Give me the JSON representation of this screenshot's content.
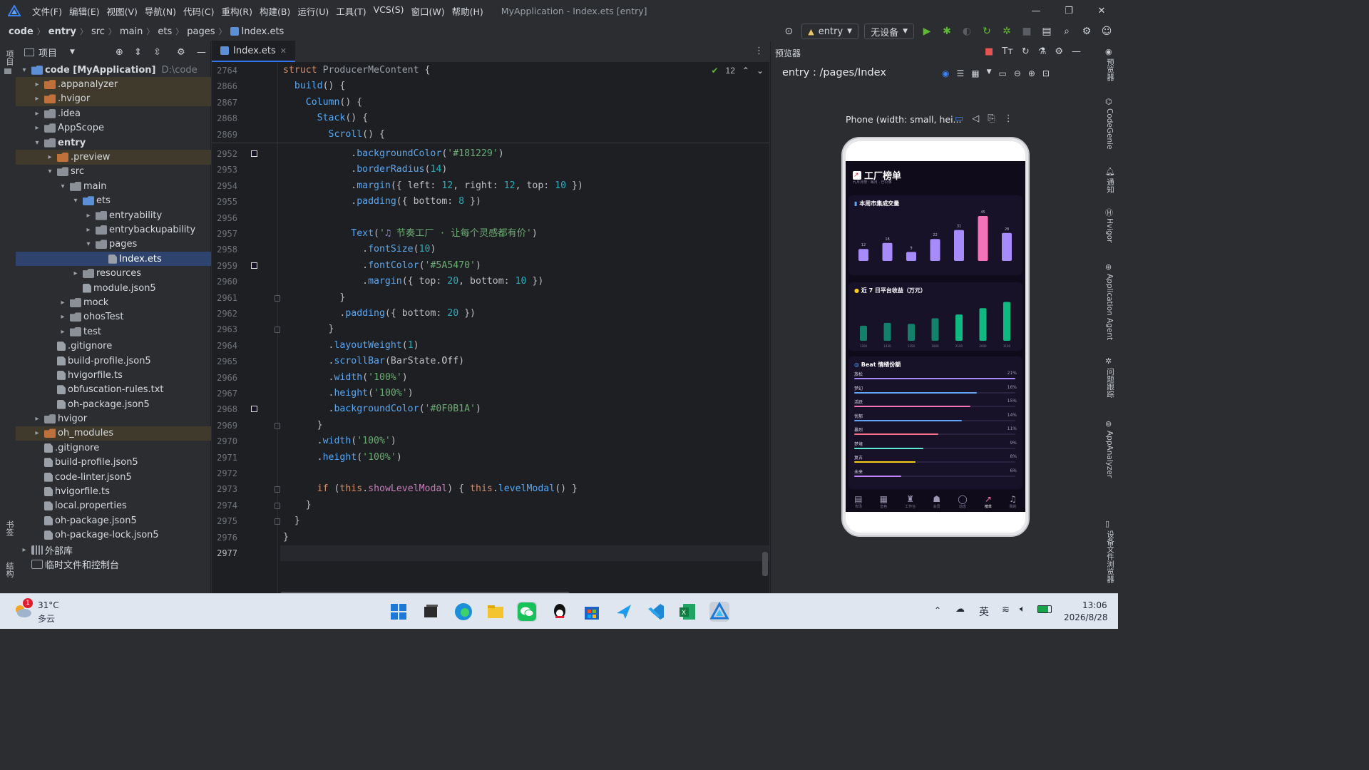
{
  "titlebar": {
    "menus": [
      "文件(F)",
      "编辑(E)",
      "视图(V)",
      "导航(N)",
      "代码(C)",
      "重构(R)",
      "构建(B)",
      "运行(U)",
      "工具(T)",
      "VCS(S)",
      "窗口(W)",
      "帮助(H)"
    ],
    "title": "MyApplication - Index.ets [entry]"
  },
  "breadcrumb": [
    "code",
    "entry",
    "src",
    "main",
    "ets",
    "pages",
    "Index.ets"
  ],
  "toolbar": {
    "module": "entry",
    "device": "无设备"
  },
  "leftstrip": {
    "project": "项目",
    "bookmarks": "书签",
    "structure": "结构"
  },
  "project": {
    "title": "项目",
    "tree": [
      {
        "label": "code [MyApplication]",
        "extra": "D:\\code",
        "depth": 0,
        "arrow": "▾",
        "kind": "folder-blue",
        "bold": true
      },
      {
        "label": ".appanalyzer",
        "depth": 1,
        "arrow": "▸",
        "kind": "folder-orange",
        "hl": true
      },
      {
        "label": ".hvigor",
        "depth": 1,
        "arrow": "▸",
        "kind": "folder-orange",
        "hl": true
      },
      {
        "label": ".idea",
        "depth": 1,
        "arrow": "▸",
        "kind": "folder"
      },
      {
        "label": "AppScope",
        "depth": 1,
        "arrow": "▸",
        "kind": "folder"
      },
      {
        "label": "entry",
        "depth": 1,
        "arrow": "▾",
        "kind": "folder",
        "bold": true
      },
      {
        "label": ".preview",
        "depth": 2,
        "arrow": "▸",
        "kind": "folder-orange",
        "hl": true
      },
      {
        "label": "src",
        "depth": 2,
        "arrow": "▾",
        "kind": "folder"
      },
      {
        "label": "main",
        "depth": 3,
        "arrow": "▾",
        "kind": "folder"
      },
      {
        "label": "ets",
        "depth": 4,
        "arrow": "▾",
        "kind": "folder-blue"
      },
      {
        "label": "entryability",
        "depth": 5,
        "arrow": "▸",
        "kind": "folder"
      },
      {
        "label": "entrybackupability",
        "depth": 5,
        "arrow": "▸",
        "kind": "folder"
      },
      {
        "label": "pages",
        "depth": 5,
        "arrow": "▾",
        "kind": "folder"
      },
      {
        "label": "Index.ets",
        "depth": 6,
        "arrow": "",
        "kind": "file",
        "sel": true
      },
      {
        "label": "resources",
        "depth": 4,
        "arrow": "▸",
        "kind": "folder"
      },
      {
        "label": "module.json5",
        "depth": 4,
        "arrow": "",
        "kind": "file"
      },
      {
        "label": "mock",
        "depth": 3,
        "arrow": "▸",
        "kind": "folder"
      },
      {
        "label": "ohosTest",
        "depth": 3,
        "arrow": "▸",
        "kind": "folder"
      },
      {
        "label": "test",
        "depth": 3,
        "arrow": "▸",
        "kind": "folder"
      },
      {
        "label": ".gitignore",
        "depth": 2,
        "arrow": "",
        "kind": "file"
      },
      {
        "label": "build-profile.json5",
        "depth": 2,
        "arrow": "",
        "kind": "file"
      },
      {
        "label": "hvigorfile.ts",
        "depth": 2,
        "arrow": "",
        "kind": "file"
      },
      {
        "label": "obfuscation-rules.txt",
        "depth": 2,
        "arrow": "",
        "kind": "file"
      },
      {
        "label": "oh-package.json5",
        "depth": 2,
        "arrow": "",
        "kind": "file"
      },
      {
        "label": "hvigor",
        "depth": 1,
        "arrow": "▸",
        "kind": "folder"
      },
      {
        "label": "oh_modules",
        "depth": 1,
        "arrow": "▸",
        "kind": "folder-orange",
        "hl": true
      },
      {
        "label": ".gitignore",
        "depth": 1,
        "arrow": "",
        "kind": "file"
      },
      {
        "label": "build-profile.json5",
        "depth": 1,
        "arrow": "",
        "kind": "file"
      },
      {
        "label": "code-linter.json5",
        "depth": 1,
        "arrow": "",
        "kind": "file"
      },
      {
        "label": "hvigorfile.ts",
        "depth": 1,
        "arrow": "",
        "kind": "file"
      },
      {
        "label": "local.properties",
        "depth": 1,
        "arrow": "",
        "kind": "file"
      },
      {
        "label": "oh-package.json5",
        "depth": 1,
        "arrow": "",
        "kind": "file"
      },
      {
        "label": "oh-package-lock.json5",
        "depth": 1,
        "arrow": "",
        "kind": "file"
      },
      {
        "label": "外部库",
        "depth": 0,
        "arrow": "▸",
        "kind": "lib"
      },
      {
        "label": "临时文件和控制台",
        "depth": 0,
        "arrow": "",
        "kind": "console"
      }
    ]
  },
  "editor": {
    "tab": "Index.ets",
    "inspection_count": "12",
    "sticky_numbers": [
      "2764",
      "2866",
      "2867",
      "2868",
      "2869"
    ],
    "line_numbers": [
      "2952",
      "2953",
      "2954",
      "2955",
      "2956",
      "2957",
      "2958",
      "2959",
      "2960",
      "2961",
      "2962",
      "2963",
      "2964",
      "2965",
      "2966",
      "2967",
      "2968",
      "2969",
      "2970",
      "2971",
      "2972",
      "2973",
      "2974",
      "2975",
      "2976",
      "2977"
    ]
  },
  "preview": {
    "panel_title": "预览器",
    "route": "entry : /pages/Index",
    "device_label": "Phone (width: small, hei...",
    "app": {
      "title": "工厂榜单",
      "subtitle": "九月月榜 · 每月 · 已公演",
      "card1_title": "本周市集成交量",
      "card1_values": [
        12,
        18,
        9,
        22,
        31,
        45,
        28
      ],
      "card2_title": "近 7 日平台收益（万元）",
      "card2_values": [
        1200,
        1430,
        1350,
        1800,
        2100,
        2600,
        3100
      ],
      "card3_title": "Beat 情绪份额",
      "moods": [
        {
          "name": "放松",
          "pct": "21%",
          "color": "#a78bfa",
          "v": 1.0
        },
        {
          "name": "梦幻",
          "pct": "16%",
          "color": "#60a5fa",
          "v": 0.76
        },
        {
          "name": "活跃",
          "pct": "15%",
          "color": "#f472b6",
          "v": 0.72
        },
        {
          "name": "忧郁",
          "pct": "14%",
          "color": "#60a5fa",
          "v": 0.67
        },
        {
          "name": "暴烈",
          "pct": "11%",
          "color": "#fb7185",
          "v": 0.52
        },
        {
          "name": "梦境",
          "pct": "9%",
          "color": "#5eead4",
          "v": 0.43
        },
        {
          "name": "复古",
          "pct": "8%",
          "color": "#facc15",
          "v": 0.38
        },
        {
          "name": "未来",
          "pct": "6%",
          "color": "#c084fc",
          "v": 0.29
        }
      ],
      "tabs": [
        "市场",
        "音色",
        "工作台",
        "会员",
        "动态",
        "榜单",
        "我的"
      ]
    }
  },
  "rightstrip": [
    "预览器",
    "CodeGenie",
    "通知",
    "Hvigor",
    "Application Agent",
    "问题跟踪",
    "AppAnalyzer",
    "设备文件浏览器"
  ],
  "taskbar": {
    "temp": "31°C",
    "weather": "多云",
    "badge": "1",
    "ime": "英",
    "time": "13:06",
    "date": "2026/8/28"
  },
  "colors": {
    "accent": "#3574f0",
    "ide_bg": "#2b2d30",
    "editor_bg": "#1e1f22",
    "app_bg": "#0F0B1A",
    "card_bg": "#181229"
  }
}
